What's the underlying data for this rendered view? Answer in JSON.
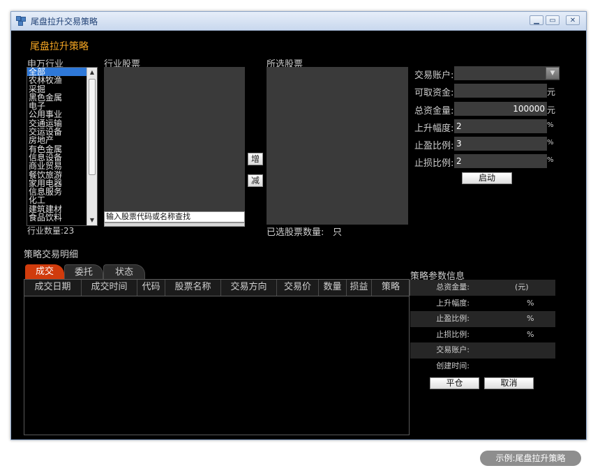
{
  "window": {
    "title": "尾盘拉升交易策略"
  },
  "heading": "尾盘拉升策略",
  "industry": {
    "label": "申万行业",
    "items": [
      "全部",
      "农林牧渔",
      "采掘",
      "黑色金属",
      "电子",
      "公用事业",
      "交通运输",
      "交运设备",
      "房地产",
      "有色金属",
      "信息设备",
      "商业贸易",
      "餐饮旅游",
      "家用电器",
      "信息服务",
      "化工",
      "建筑建材",
      "食品饮料"
    ],
    "selected": "全部",
    "count_label": "行业数量:23"
  },
  "stocks": {
    "label": "行业股票",
    "search_placeholder": "输入股票代码或名称查找"
  },
  "buttons": {
    "add": "增",
    "remove": "减",
    "start": "启动",
    "close_position": "平仓",
    "cancel": "取消"
  },
  "selected": {
    "label": "所选股票",
    "count_label": "已选股票数量:",
    "count_unit": "只"
  },
  "form": {
    "account_label": "交易账户:",
    "available_label": "可取资金:",
    "available_unit": "元",
    "total_label": "总资金量:",
    "total_value": "100000",
    "total_unit": "元",
    "rise_label": "上升幅度:",
    "rise_value": "2",
    "rise_unit": "%",
    "profit_label": "止盈比例:",
    "profit_value": "3",
    "profit_unit": "%",
    "loss_label": "止损比例:",
    "loss_value": "2",
    "loss_unit": "%"
  },
  "detail": {
    "label": "策略交易明细",
    "tabs": [
      "成交",
      "委托",
      "状态"
    ],
    "columns": [
      "成交日期",
      "成交时间",
      "代码",
      "股票名称",
      "交易方向",
      "交易价",
      "数量",
      "损益",
      "策略"
    ]
  },
  "params": {
    "label": "策略参数信息",
    "rows": [
      {
        "key": "总资金量:",
        "value": "(元)"
      },
      {
        "key": "上升幅度:",
        "value": "%"
      },
      {
        "key": "止盈比例:",
        "value": "%"
      },
      {
        "key": "止损比例:",
        "value": "%"
      },
      {
        "key": "交易账户:",
        "value": ""
      },
      {
        "key": "创建时间:",
        "value": ""
      }
    ]
  },
  "footer_badge": "示例:尾盘拉升策略",
  "colors": {
    "accent": "#f5a623",
    "tab_active": "#d03b0c",
    "selection": "#2e78d8"
  }
}
